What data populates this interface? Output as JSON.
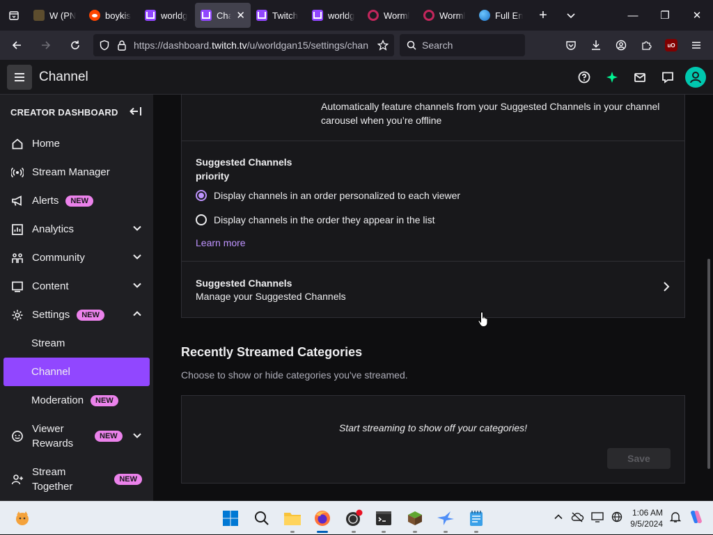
{
  "browser": {
    "tabs": [
      {
        "label": "W (PN",
        "favicon": "pn-favicon"
      },
      {
        "label": "boykis",
        "favicon": "reddit-favicon"
      },
      {
        "label": "worldg",
        "favicon": "twitch-favicon"
      },
      {
        "label": "Cha",
        "favicon": "twitch-favicon",
        "active": true
      },
      {
        "label": "Twitch",
        "favicon": "twitch-favicon"
      },
      {
        "label": "worldg",
        "favicon": "twitch-favicon"
      },
      {
        "label": "Worml",
        "favicon": "wormhole-favicon"
      },
      {
        "label": "Worml",
        "favicon": "wormhole-favicon"
      },
      {
        "label": "Full En",
        "favicon": "globe-favicon"
      }
    ],
    "url_prefix": "https://dashboard.",
    "url_domain": "twitch.tv",
    "url_suffix": "/u/worldgan15/settings/chan",
    "search_placeholder": "Search"
  },
  "header": {
    "title": "Channel"
  },
  "sidebar": {
    "heading": "CREATOR DASHBOARD",
    "items": [
      {
        "label": "Home"
      },
      {
        "label": "Stream Manager"
      },
      {
        "label": "Alerts",
        "badge": "NEW"
      },
      {
        "label": "Analytics"
      },
      {
        "label": "Community"
      },
      {
        "label": "Content"
      },
      {
        "label": "Settings",
        "badge": "NEW"
      }
    ],
    "settings_sub": {
      "stream": "Stream",
      "channel": "Channel",
      "moderation": "Moderation",
      "moderation_badge": "NEW"
    },
    "viewer_rewards": "Viewer Rewards",
    "viewer_rewards_badge": "NEW",
    "stream_together": "Stream Together",
    "stream_together_badge": "NEW"
  },
  "main": {
    "offline_text": "Automatically feature channels from your Suggested Channels in your channel carousel when you’re offline",
    "priority_title": "Suggested Channels priority",
    "radio_options": [
      {
        "label": "Display channels in an order personalized to each viewer",
        "checked": true
      },
      {
        "label": "Display channels in the order they appear in the list",
        "checked": false
      }
    ],
    "learn_more": "Learn more",
    "manage_title": "Suggested Channels",
    "manage_desc": "Manage your Suggested Channels",
    "recent_title": "Recently Streamed Categories",
    "recent_desc": "Choose to show or hide categories you've streamed.",
    "empty_message": "Start streaming to show off your categories!",
    "save_label": "Save"
  },
  "taskbar": {
    "time": "1:06 AM",
    "date": "9/5/2024"
  },
  "colors": {
    "accent": "#9147ff",
    "link": "#bf94ff",
    "badge": "#eb82eb"
  }
}
